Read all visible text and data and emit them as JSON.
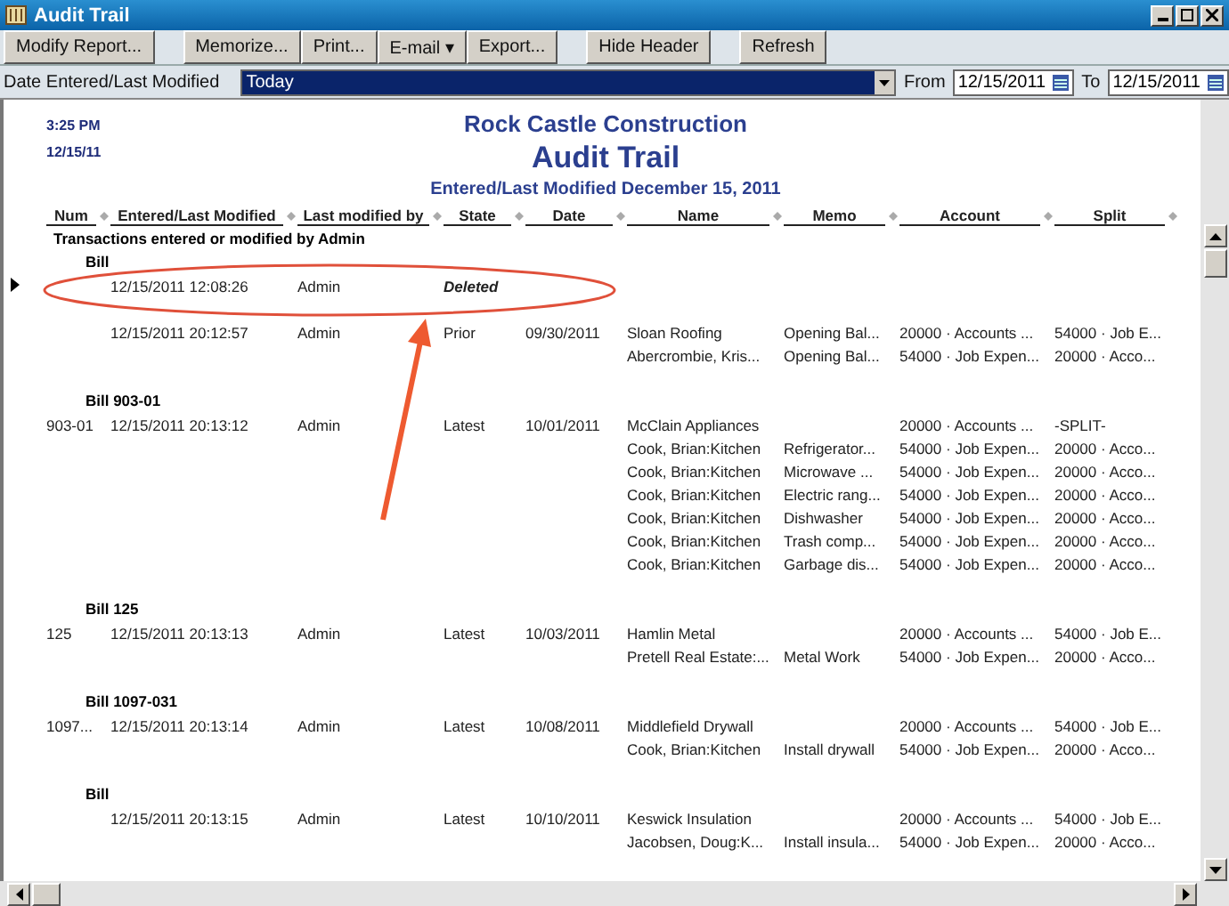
{
  "window": {
    "title": "Audit Trail"
  },
  "toolbar": [
    "Modify Report...",
    "Memorize...",
    "Print...",
    "E-mail ▾",
    "Export...",
    "Hide Header",
    "Refresh"
  ],
  "filter": {
    "label": "Date Entered/Last Modified",
    "range": "Today",
    "from_label": "From",
    "from": "12/15/2011",
    "to_label": "To",
    "to": "12/15/2011"
  },
  "report": {
    "time": "3:25 PM",
    "date": "12/15/11",
    "company": "Rock Castle Construction",
    "title": "Audit Trail",
    "subtitle": "Entered/Last Modified December 15, 2011",
    "columns": [
      "Num",
      "Entered/Last Modified",
      "Last modified by",
      "State",
      "Date",
      "Name",
      "Memo",
      "Account",
      "Split"
    ],
    "section": "Transactions entered or modified by Admin",
    "groups": [
      {
        "title": "Bill",
        "rows": [
          {
            "selected": true,
            "kind": "deleted",
            "entered": "12/15/2011 12:08:26",
            "by": "Admin",
            "state": "Deleted"
          },
          {
            "selected": false,
            "kind": "normal",
            "entered": "12/15/2011 20:12:57",
            "by": "Admin",
            "state": "Prior",
            "date": "09/30/2011",
            "name": "Sloan Roofing",
            "memo": "Opening Bal...",
            "account": "20000 · Accounts ...",
            "split": "54000 · Job E..."
          },
          {
            "selected": false,
            "kind": "normal",
            "name": "Abercrombie, Kris...",
            "memo": "Opening Bal...",
            "account": "54000 · Job Expen...",
            "split": "20000 · Acco..."
          }
        ]
      },
      {
        "title": "Bill 903-01",
        "rows": [
          {
            "selected": false,
            "kind": "normal",
            "num": "903-01",
            "entered": "12/15/2011 20:13:12",
            "by": "Admin",
            "state": "Latest",
            "date": "10/01/2011",
            "name": "McClain Appliances",
            "account": "20000 · Accounts ...",
            "split": "-SPLIT-"
          },
          {
            "selected": false,
            "kind": "normal",
            "name": "Cook, Brian:Kitchen",
            "memo": "Refrigerator...",
            "account": "54000 · Job Expen...",
            "split": "20000 · Acco..."
          },
          {
            "selected": false,
            "kind": "normal",
            "name": "Cook, Brian:Kitchen",
            "memo": "Microwave ...",
            "account": "54000 · Job Expen...",
            "split": "20000 · Acco..."
          },
          {
            "selected": false,
            "kind": "normal",
            "name": "Cook, Brian:Kitchen",
            "memo": "Electric rang...",
            "account": "54000 · Job Expen...",
            "split": "20000 · Acco..."
          },
          {
            "selected": false,
            "kind": "normal",
            "name": "Cook, Brian:Kitchen",
            "memo": "Dishwasher",
            "account": "54000 · Job Expen...",
            "split": "20000 · Acco..."
          },
          {
            "selected": false,
            "kind": "normal",
            "name": "Cook, Brian:Kitchen",
            "memo": "Trash comp...",
            "account": "54000 · Job Expen...",
            "split": "20000 · Acco..."
          },
          {
            "selected": false,
            "kind": "normal",
            "name": "Cook, Brian:Kitchen",
            "memo": "Garbage dis...",
            "account": "54000 · Job Expen...",
            "split": "20000 · Acco..."
          }
        ]
      },
      {
        "title": "Bill 125",
        "rows": [
          {
            "selected": false,
            "kind": "normal",
            "num": "125",
            "entered": "12/15/2011 20:13:13",
            "by": "Admin",
            "state": "Latest",
            "date": "10/03/2011",
            "name": "Hamlin Metal",
            "account": "20000 · Accounts ...",
            "split": "54000 · Job E..."
          },
          {
            "selected": false,
            "kind": "normal",
            "name": "Pretell Real Estate:...",
            "memo": "Metal Work",
            "account": "54000 · Job Expen...",
            "split": "20000 · Acco..."
          }
        ]
      },
      {
        "title": "Bill 1097-031",
        "rows": [
          {
            "selected": false,
            "kind": "normal",
            "num": "1097...",
            "entered": "12/15/2011 20:13:14",
            "by": "Admin",
            "state": "Latest",
            "date": "10/08/2011",
            "name": "Middlefield Drywall",
            "account": "20000 · Accounts ...",
            "split": "54000 · Job E..."
          },
          {
            "selected": false,
            "kind": "normal",
            "name": "Cook, Brian:Kitchen",
            "memo": "Install drywall",
            "account": "54000 · Job Expen...",
            "split": "20000 · Acco..."
          }
        ]
      },
      {
        "title": "Bill",
        "rows": [
          {
            "selected": false,
            "kind": "normal",
            "entered": "12/15/2011 20:13:15",
            "by": "Admin",
            "state": "Latest",
            "date": "10/10/2011",
            "name": "Keswick Insulation",
            "account": "20000 · Accounts ...",
            "split": "54000 · Job E..."
          },
          {
            "selected": false,
            "kind": "normal",
            "name": "Jacobsen, Doug:K...",
            "memo": "Install insula...",
            "account": "54000 · Job Expen...",
            "split": "20000 · Acco..."
          }
        ]
      }
    ]
  }
}
